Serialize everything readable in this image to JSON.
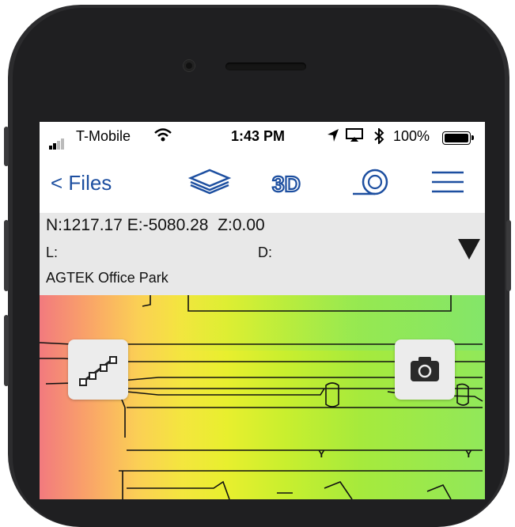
{
  "status_bar": {
    "carrier": "T-Mobile",
    "time": "1:43 PM",
    "battery_percent": "100%",
    "signal_bars": 2,
    "icons": [
      "signal-icon",
      "wifi-icon",
      "location-arrow-icon",
      "airplay-icon",
      "bluetooth-icon",
      "battery-icon"
    ]
  },
  "nav_bar": {
    "back_label": "< Files",
    "buttons": [
      "layers-icon",
      "3d-view-icon",
      "measure-tape-icon",
      "menu-icon"
    ],
    "three_d_label": "3D"
  },
  "info_panel": {
    "coordinates": "N:1217.17 E:-5080.28  Z:0.00",
    "l_label": "L:",
    "d_label": "D:",
    "site_name": "AGTEK Office Park",
    "dropdown_icon": "dropdown-triangle-icon"
  },
  "map_tools": {
    "left_tool_icon": "profile-points-icon",
    "right_tool_icon": "camera-icon"
  },
  "colors": {
    "accent_blue": "#1d4fa0",
    "info_bg": "#e8e8e8",
    "heat_low": "#f27a7e",
    "heat_mid": "#f4e63e",
    "heat_high": "#91e85a"
  }
}
